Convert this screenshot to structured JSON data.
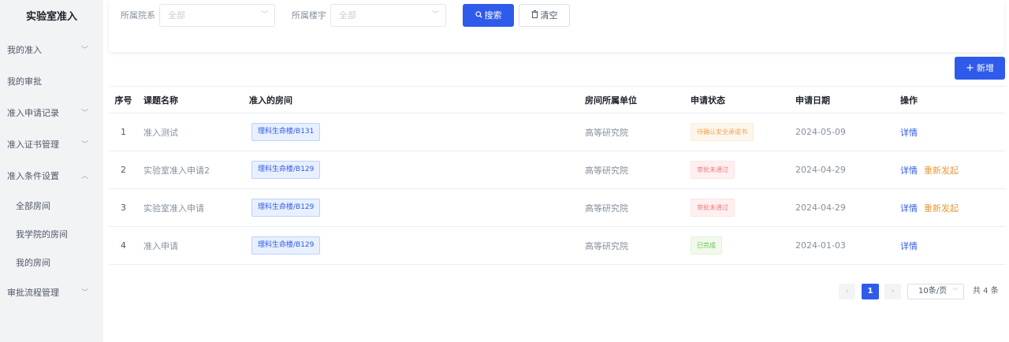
{
  "sidebar": {
    "title": "实验室准入",
    "items": [
      {
        "label": "我的准入"
      },
      {
        "label": "我的审批"
      },
      {
        "label": "准入申请记录"
      },
      {
        "label": "准入证书管理"
      },
      {
        "label": "准入条件设置"
      },
      {
        "label": "全部房间"
      },
      {
        "label": "我学院的房间"
      },
      {
        "label": "我的房间"
      },
      {
        "label": "审批流程管理"
      }
    ]
  },
  "filters": {
    "department_label": "所属院系",
    "department_value": "全部",
    "building_label": "所属楼宇",
    "building_value": "全部",
    "search_label": "搜索",
    "clear_label": "清空"
  },
  "add_label": "新增",
  "table": {
    "headers": [
      "序号",
      "课题名称",
      "准入的房间",
      "房间所属单位",
      "申请状态",
      "申请日期",
      "操作"
    ],
    "rows": [
      {
        "index": "1",
        "topic": "准入测试",
        "room": "理科生命楼/B131",
        "unit": "高等研究院",
        "status": "待确认安全承诺书",
        "status_type": "warning",
        "date": "2024-05-09",
        "actions": [
          "详情"
        ]
      },
      {
        "index": "2",
        "topic": "实验室准入申请2",
        "room": "理科生命楼/B129",
        "unit": "高等研究院",
        "status": "审批未通过",
        "status_type": "danger",
        "date": "2024-04-29",
        "actions": [
          "详情",
          "重新发起"
        ]
      },
      {
        "index": "3",
        "topic": "实验室准入申请",
        "room": "理科生命楼/B129",
        "unit": "高等研究院",
        "status": "审批未通过",
        "status_type": "danger",
        "date": "2024-04-29",
        "actions": [
          "详情",
          "重新发起"
        ]
      },
      {
        "index": "4",
        "topic": "准入申请",
        "room": "理科生命楼/B129",
        "unit": "高等研究院",
        "status": "已完成",
        "status_type": "success",
        "date": "2024-01-03",
        "actions": [
          "详情"
        ]
      }
    ]
  },
  "pagination": {
    "current_page": "1",
    "page_size": "10条/页",
    "total": "共 4 条"
  },
  "colors": {
    "primary": "#2f5bea",
    "warning": "#f0a34a",
    "danger": "#f27c7c",
    "success": "#6cc24a"
  }
}
